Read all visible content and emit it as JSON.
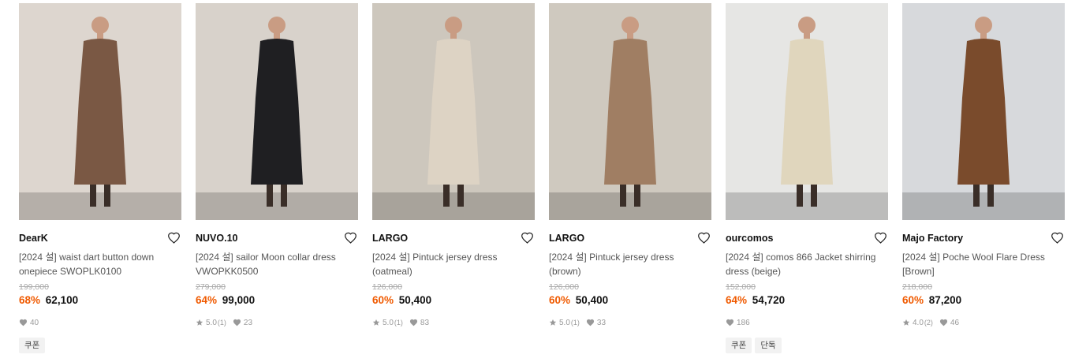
{
  "products": [
    {
      "brand": "DearK",
      "name": "[2024 설] waist dart button down onepiece SWOPLK0100",
      "original_price": "199,000",
      "discount_rate": "68%",
      "price": "62,100",
      "rating": "",
      "review_count": "",
      "likes": "40",
      "tags": [
        "쿠폰"
      ],
      "colors": {
        "bg": "#ddd6cf",
        "dress": "#7a5844"
      }
    },
    {
      "brand": "NUVO.10",
      "name": "[2024 설] sailor Moon collar dress VWOPKK0500",
      "original_price": "279,000",
      "discount_rate": "64%",
      "price": "99,000",
      "rating": "5.0",
      "review_count": "(1)",
      "likes": "23",
      "tags": [],
      "colors": {
        "bg": "#d8d2cb",
        "dress": "#1f1f22"
      }
    },
    {
      "brand": "LARGO",
      "name": "[2024 설] Pintuck jersey dress (oatmeal)",
      "original_price": "126,000",
      "discount_rate": "60%",
      "price": "50,400",
      "rating": "5.0",
      "review_count": "(1)",
      "likes": "83",
      "tags": [],
      "colors": {
        "bg": "#cdc7bd",
        "dress": "#ddd3c4"
      }
    },
    {
      "brand": "LARGO",
      "name": "[2024 설] Pintuck jersey dress (brown)",
      "original_price": "126,000",
      "discount_rate": "60%",
      "price": "50,400",
      "rating": "5.0",
      "review_count": "(1)",
      "likes": "33",
      "tags": [],
      "colors": {
        "bg": "#cfc9bf",
        "dress": "#a07e63"
      }
    },
    {
      "brand": "ourcomos",
      "name": "[2024 설] comos 866 Jacket shirring dress (beige)",
      "original_price": "152,000",
      "discount_rate": "64%",
      "price": "54,720",
      "rating": "",
      "review_count": "",
      "likes": "186",
      "tags": [
        "쿠폰",
        "단독"
      ],
      "colors": {
        "bg": "#e6e6e4",
        "dress": "#e0d6bd"
      }
    },
    {
      "brand": "Majo Factory",
      "name": "[2024 설] Poche Wool Flare Dress [Brown]",
      "original_price": "218,000",
      "discount_rate": "60%",
      "price": "87,200",
      "rating": "4.0",
      "review_count": "(2)",
      "likes": "46",
      "tags": [],
      "colors": {
        "bg": "#d7d9dc",
        "dress": "#7a4b2c"
      }
    }
  ],
  "icons": {
    "wish": "heart-outline-icon",
    "rating": "star-icon",
    "likes": "heart-filled-icon"
  },
  "colors": {
    "discount": "#f05a00",
    "tag_bg": "#f2f2f2"
  }
}
